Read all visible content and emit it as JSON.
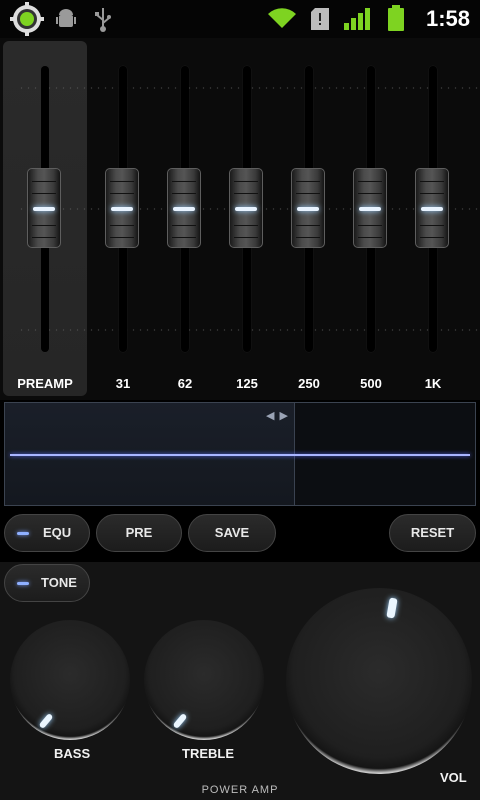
{
  "status_bar": {
    "time": "1:58",
    "icons": [
      "poweramp-app-icon",
      "android-debug-icon",
      "usb-icon",
      "wifi-icon",
      "sd-card-icon",
      "signal-icon",
      "battery-icon"
    ]
  },
  "equalizer": {
    "bands": [
      {
        "label": "PREAMP",
        "level": 0
      },
      {
        "label": "31",
        "level": 0
      },
      {
        "label": "62",
        "level": 0
      },
      {
        "label": "125",
        "level": 0
      },
      {
        "label": "250",
        "level": 0
      },
      {
        "label": "500",
        "level": 0
      },
      {
        "label": "1K",
        "level": 0
      }
    ]
  },
  "buttons": {
    "equ": "EQU",
    "pre": "PRE",
    "save": "SAVE",
    "reset": "RESET",
    "tone": "TONE"
  },
  "knobs": {
    "bass": "BASS",
    "treble": "TREBLE",
    "vol": "VOL"
  },
  "brand": "POWER AMP",
  "colors": {
    "accent": "#9cd0ff",
    "curve": "#a9b5ff",
    "battery": "#7ed321",
    "wifi": "#7ed321"
  }
}
